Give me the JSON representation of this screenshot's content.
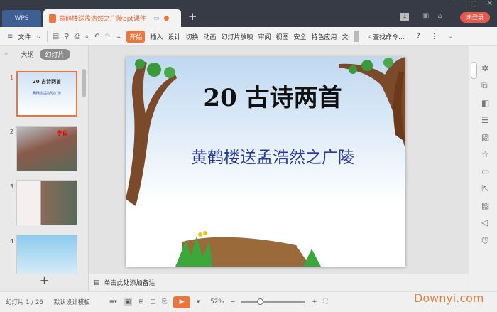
{
  "titlebar": {
    "wps_label": "WPS",
    "doc_tab": "黄鹤楼送孟浩然之广陵ppt课件",
    "new_tab": "+",
    "badge": "1",
    "login": "未登录",
    "window": [
      "—",
      "□",
      "✕"
    ]
  },
  "toolbar": {
    "file": "文件",
    "tabs": [
      "开始",
      "插入",
      "设计",
      "切换",
      "动画",
      "幻灯片放映",
      "审阅",
      "视图",
      "安全",
      "特色应用",
      "文"
    ],
    "search": "查找命令...",
    "help": "?"
  },
  "left": {
    "outline_tab": "大纲",
    "slides_tab": "幻灯片",
    "slides": [
      "1",
      "2",
      "3",
      "4"
    ],
    "thumb1_title": "20 古诗两首",
    "thumb2_text": "李白"
  },
  "slide": {
    "title": "20  古诗两首",
    "subtitle": "黄鹤楼送孟浩然之广陵"
  },
  "notes": {
    "placeholder": "单击此处添加备注"
  },
  "status": {
    "slide_count": "幻灯片 1 / 26",
    "template": "默认设计模板",
    "zoom": "52%",
    "zoom_minus": "−",
    "zoom_plus": "+"
  },
  "watermark": "Downyi.com"
}
